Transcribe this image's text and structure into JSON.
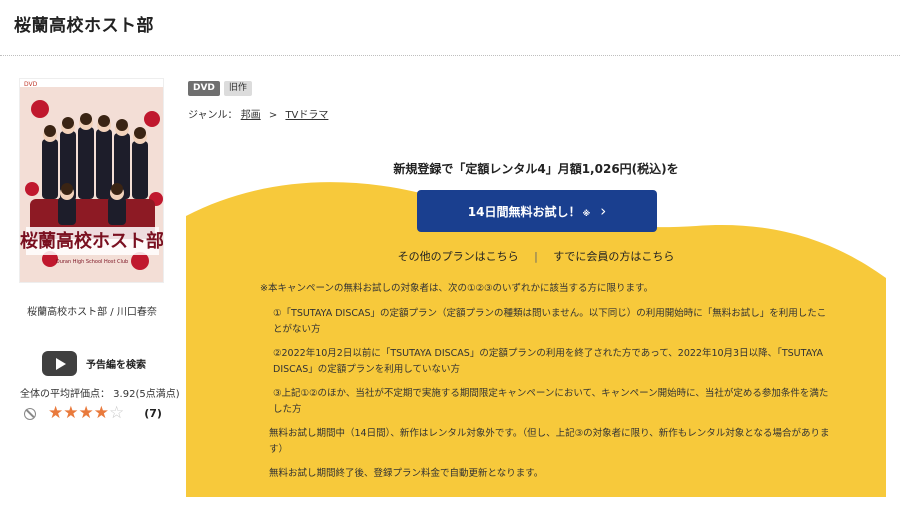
{
  "header": {
    "title": "桜蘭高校ホスト部"
  },
  "item": {
    "cover_alt": "桜蘭高校ホスト部",
    "cover_label_top": "DVD",
    "cover_logo": "桜蘭高校ホスト部",
    "cover_sub": "Ouran High School Host Club",
    "caption": "桜蘭高校ホスト部 / 川口春奈",
    "trailer_label": "予告編を検索",
    "avg_rating_text": "全体の平均評価点： 3.92(5点満点)",
    "rating_stars": 4,
    "rating_max": 5,
    "review_count": "(7)"
  },
  "badges": {
    "format": "DVD",
    "old": "旧作"
  },
  "genre": {
    "label": "ジャンル：",
    "parent": "邦画",
    "separator": ">",
    "child": "TVドラマ"
  },
  "campaign": {
    "headline": "新規登録で「定額レンタル4」月額1,026円(税込)を",
    "cta_label": "14日間無料お試し！",
    "cta_note": "※",
    "cta_chevron": "›",
    "other_plans": "その他のプランはこちら",
    "divider": "|",
    "member_link": "すでに会員の方はこちら",
    "colors": {
      "yellow": "#f7c93b",
      "cta": "#1a3f8f"
    }
  },
  "notes": {
    "intro": "※本キャンペーンの無料お試しの対象者は、次の①②③のいずれかに該当する方に限ります。",
    "cond1": "①「TSUTAYA DISCAS」の定額プラン（定額プランの種類は問いません。以下同じ）の利用開始時に「無料お試し」を利用したことがない方",
    "cond2": "②2022年10月2日以前に「TSUTAYA DISCAS」の定額プランの利用を終了された方であって、2022年10月3日以降、「TSUTAYA DISCAS」の定額プランを利用していない方",
    "cond3": "③上記①②のほか、当社が不定期で実施する期間限定キャンペーンにおいて、キャンペーン開始時に、当社が定める参加条件を満たした方",
    "trial": "無料お試し期間中（14日間）、新作はレンタル対象外です。（但し、上記③の対象者に限り、新作もレンタル対象となる場合があります）",
    "renewal": "無料お試し期間終了後、登録プラン料金で自動更新となります。"
  }
}
